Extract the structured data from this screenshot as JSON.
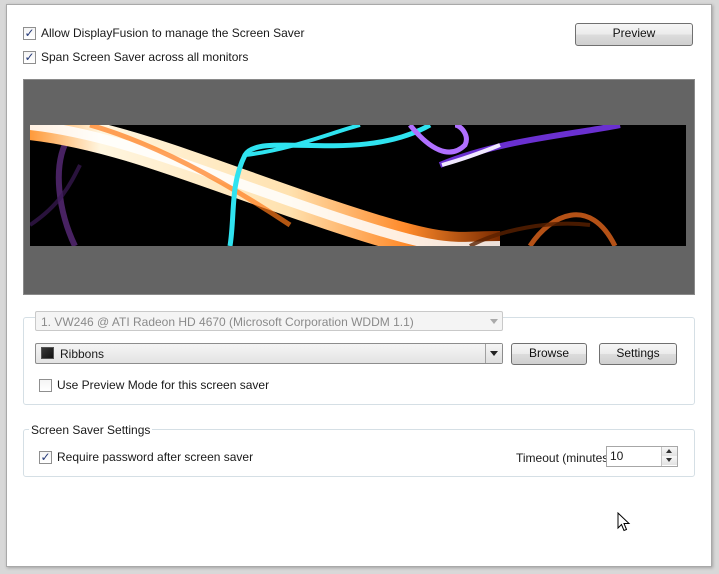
{
  "options": {
    "allow_manage": {
      "label": "Allow DisplayFusion to manage the Screen Saver",
      "checked": true
    },
    "span_monitors": {
      "label": "Span Screen Saver across all monitors",
      "checked": true
    }
  },
  "preview_button": "Preview",
  "monitor_select": {
    "value": "1. VW246 @ ATI Radeon HD 4670 (Microsoft Corporation WDDM 1.1)"
  },
  "saver_select": {
    "value": "Ribbons",
    "icon": "screen-saver-icon"
  },
  "browse_button": "Browse",
  "settings_button": "Settings",
  "preview_mode": {
    "label": "Use Preview Mode for this screen saver",
    "checked": false
  },
  "settings_group": {
    "title": "Screen Saver Settings",
    "require_password": {
      "label": "Require password after screen saver",
      "checked": true
    },
    "timeout_label": "Timeout (minutes):",
    "timeout_value": "10"
  },
  "colors": {
    "preview_bg": "#646464",
    "check_mark": "#263a78"
  }
}
